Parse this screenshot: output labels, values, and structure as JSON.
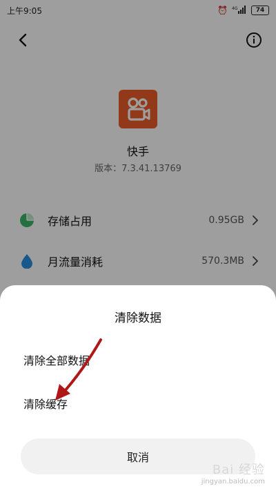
{
  "status_bar": {
    "time": "上午9:05",
    "alarm_glyph": "⏰",
    "signal_text": "4G",
    "battery_level": "74"
  },
  "nav": {
    "back_icon": "chevron-left-icon",
    "info_icon": "info-circle-icon"
  },
  "app": {
    "name": "快手",
    "version": "版本：7.3.41.13769",
    "icon_color": "#ec5c2a"
  },
  "rows": [
    {
      "label": "存储占用",
      "value": "0.95GB",
      "icon": "pie-chart-icon",
      "icon_color": "#3cb56b"
    },
    {
      "label": "月流量消耗",
      "value": "570.3MB",
      "icon": "water-drop-icon",
      "icon_color": "#2a8fe0"
    }
  ],
  "sheet": {
    "title": "清除数据",
    "options": [
      "清除全部数据",
      "清除缓存"
    ],
    "cancel_label": "取消"
  },
  "annotation": {
    "arrow_color": "#b01717"
  },
  "watermark": {
    "main": "Bai 经验",
    "sub": "jingyan.baidu.com"
  }
}
